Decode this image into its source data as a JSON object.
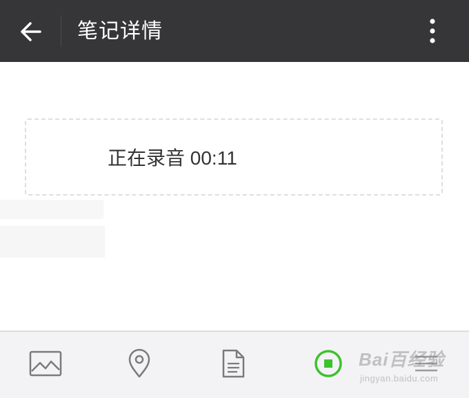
{
  "header": {
    "title": "笔记详情",
    "back_icon": "arrow-left-icon",
    "more_icon": "more-vertical-icon",
    "background_color": "#363638"
  },
  "recording": {
    "status_text": "正在录音 00:11"
  },
  "toolbar": {
    "items": [
      {
        "icon": "image-icon"
      },
      {
        "icon": "location-pin-icon"
      },
      {
        "icon": "document-icon"
      },
      {
        "icon": "record-stop-icon",
        "active_color": "#3cc22c"
      },
      {
        "icon": "menu-icon"
      }
    ]
  },
  "watermark": {
    "text": "Bai百经验",
    "subtext": "jingyan.baidu.com"
  }
}
